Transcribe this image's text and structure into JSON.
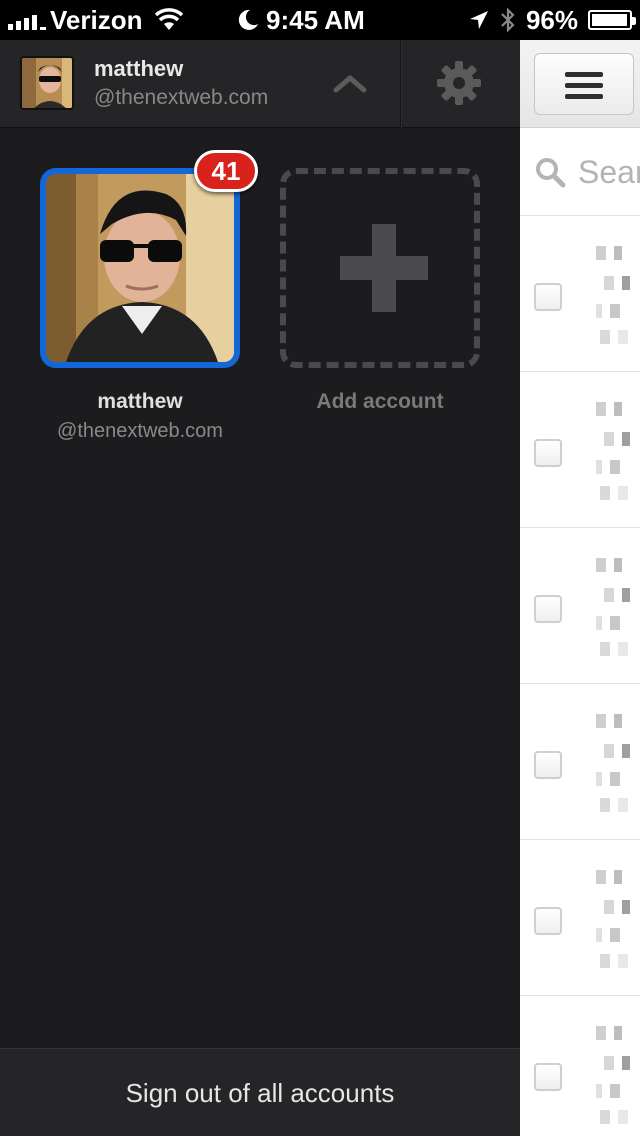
{
  "status_bar": {
    "carrier": "Verizon",
    "time": "9:45 AM",
    "battery": "96%",
    "battery_level": 0.96
  },
  "drawer": {
    "header": {
      "name": "matthew",
      "email": "@thenextweb.com"
    },
    "accounts": [
      {
        "name": "matthew",
        "email": "@thenextweb.com",
        "badge": "41"
      }
    ],
    "add_account_label": "Add account",
    "sign_out_label": "Sign out of all accounts"
  },
  "main": {
    "search_placeholder": "Sear"
  },
  "icons": [
    "signal-icon",
    "wifi-icon",
    "moon-icon",
    "location-icon",
    "bluetooth-icon",
    "battery-icon",
    "chevron-up-icon",
    "gear-icon",
    "plus-icon",
    "menu-icon",
    "search-icon"
  ],
  "colors": {
    "accent_blue": "#1367d8",
    "badge_red": "#d9221b",
    "drawer_bg": "#1c1c1e"
  }
}
